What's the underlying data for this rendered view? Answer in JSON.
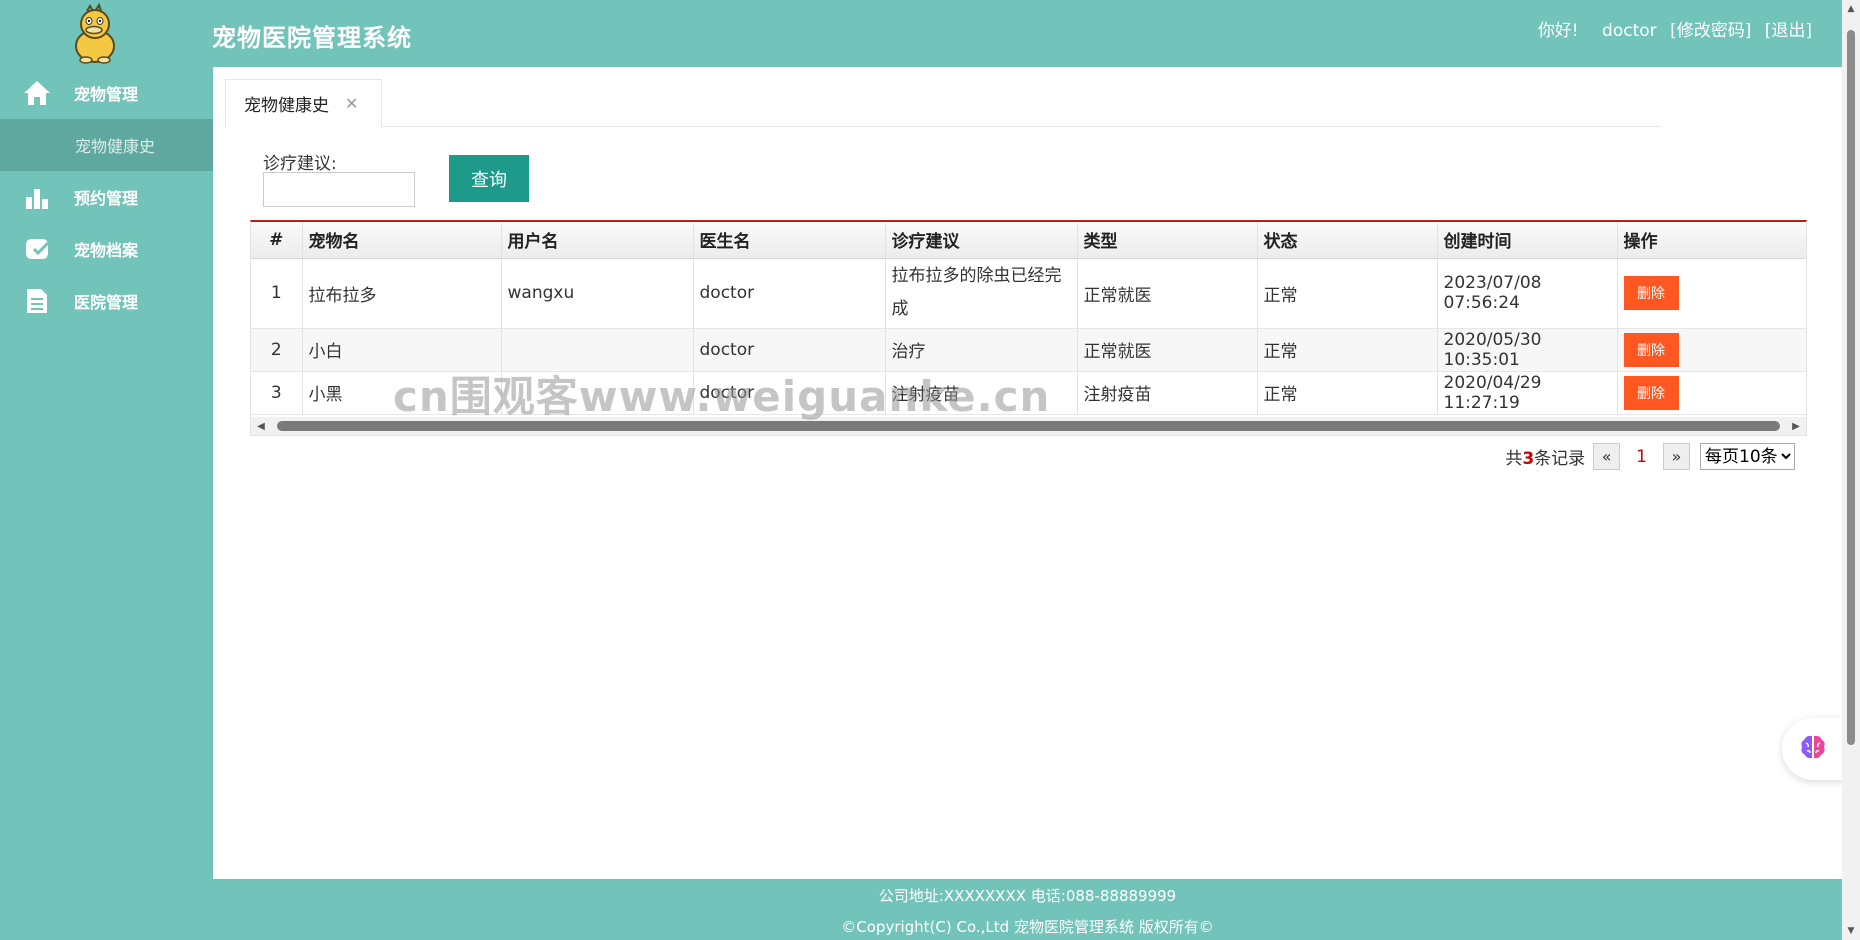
{
  "header": {
    "title": "宠物医院管理系统",
    "greeting": "你好!",
    "username": "doctor",
    "change_password": "[修改密码]",
    "logout": "[退出]"
  },
  "sidebar": {
    "items": [
      {
        "label": "宠物管理",
        "icon": "home-icon"
      },
      {
        "label": "预约管理",
        "icon": "bar-chart-icon"
      },
      {
        "label": "宠物档案",
        "icon": "pet-record-icon"
      },
      {
        "label": "医院管理",
        "icon": "document-icon"
      }
    ],
    "sub_item": "宠物健康史"
  },
  "tabs": [
    {
      "label": "宠物健康史"
    }
  ],
  "filter": {
    "label": "诊疗建议:",
    "value": "",
    "button": "查询"
  },
  "table": {
    "columns": [
      "#",
      "宠物名",
      "用户名",
      "医生名",
      "诊疗建议",
      "类型",
      "状态",
      "创建时间",
      "操作"
    ],
    "rows": [
      {
        "no": "1",
        "pet": "拉布拉多",
        "user": "wangxu",
        "doctor": "doctor",
        "advice": "拉布拉多的除虫已经完成",
        "type": "正常就医",
        "status": "正常",
        "created": "2023/07/08 07:56:24",
        "action": "删除"
      },
      {
        "no": "2",
        "pet": "小白",
        "user": "",
        "doctor": "doctor",
        "advice": "治疗",
        "type": "正常就医",
        "status": "正常",
        "created": "2020/05/30 10:35:01",
        "action": "删除"
      },
      {
        "no": "3",
        "pet": "小黑",
        "user": "",
        "doctor": "doctor",
        "advice": "注射疫苗",
        "type": "注射疫苗",
        "status": "正常",
        "created": "2020/04/29 11:27:19",
        "action": "删除"
      }
    ]
  },
  "watermark": "cn围观客www.weiguanke.cn",
  "pagination": {
    "total_prefix": "共",
    "total": "3",
    "total_suffix": "条记录",
    "prev": "«",
    "current": "1",
    "next": "»",
    "per_page": "每页10条"
  },
  "footer": {
    "address": "公司地址:XXXXXXXX 电话:088-88889999",
    "copyright": "©Copyright(C) Co.,Ltd 宠物医院管理系统 版权所有©"
  },
  "colors": {
    "theme": "#72c3b9",
    "primary_button": "#1e9a8b",
    "danger_button": "#ff5722",
    "table_top_border": "#b22222"
  }
}
